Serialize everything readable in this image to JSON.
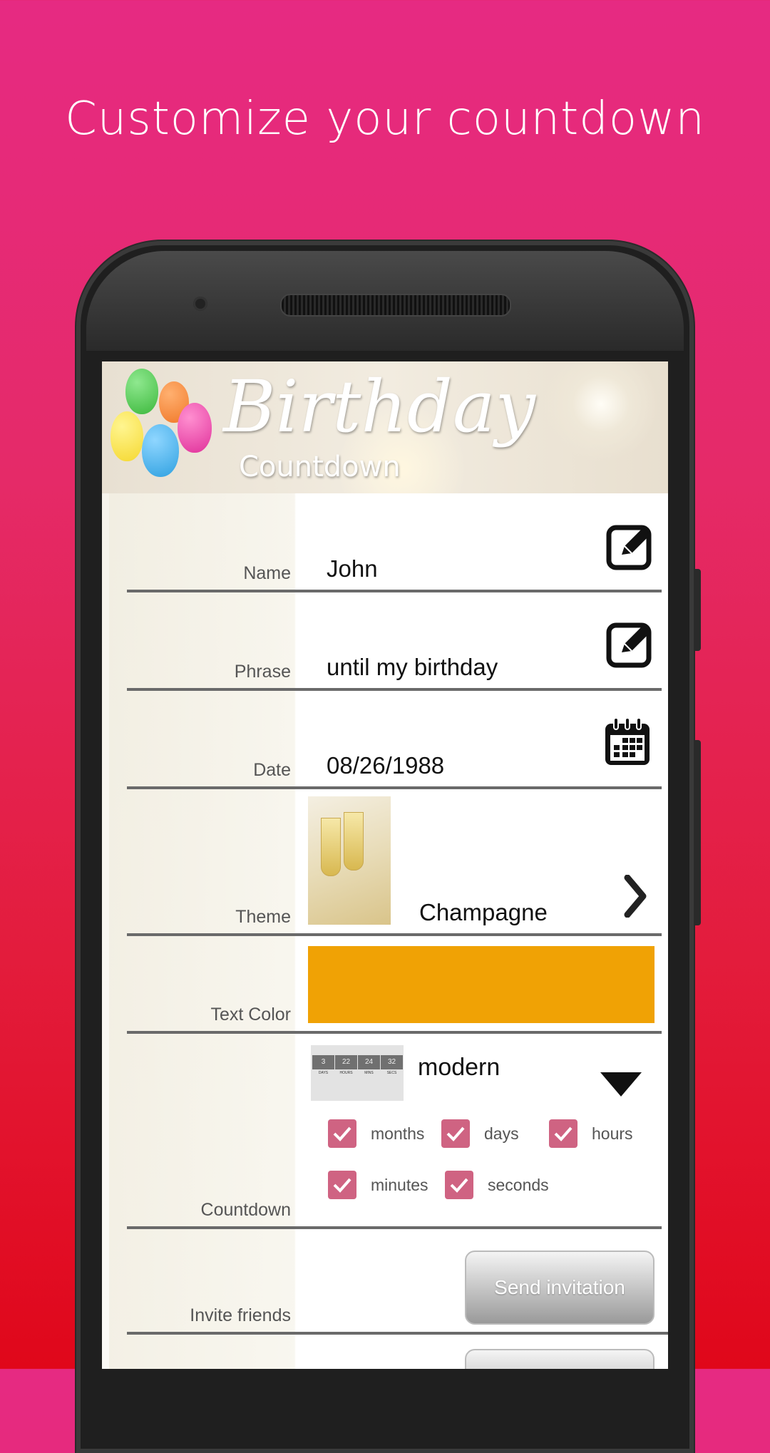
{
  "headline": "Customize your countdown",
  "banner": {
    "title": "Birthday",
    "subtitle": "Countdown"
  },
  "form": {
    "name": {
      "label": "Name",
      "value": "John",
      "icon": "edit-icon"
    },
    "phrase": {
      "label": "Phrase",
      "value": "until my birthday",
      "icon": "edit-icon"
    },
    "date": {
      "label": "Date",
      "value": "08/26/1988",
      "icon": "calendar-icon"
    },
    "theme": {
      "label": "Theme",
      "value": "Champagne",
      "icon": "chevron-right-icon"
    },
    "text_color": {
      "label": "Text Color",
      "color": "#f0a205"
    },
    "countdown": {
      "label": "Countdown",
      "style": "modern",
      "preview": {
        "cells": [
          "3",
          "22",
          "24",
          "32"
        ],
        "captions": [
          "DAYS",
          "HOURS",
          "MINS",
          "SECS"
        ]
      },
      "units": [
        {
          "label": "months",
          "checked": true
        },
        {
          "label": "days",
          "checked": true
        },
        {
          "label": "hours",
          "checked": true
        },
        {
          "label": "minutes",
          "checked": true
        },
        {
          "label": "seconds",
          "checked": true
        }
      ]
    },
    "invite": {
      "label": "Invite friends",
      "button": "Send invitation"
    }
  },
  "colors": {
    "checkbox": "#cf6382",
    "accent": "#e62a82"
  }
}
